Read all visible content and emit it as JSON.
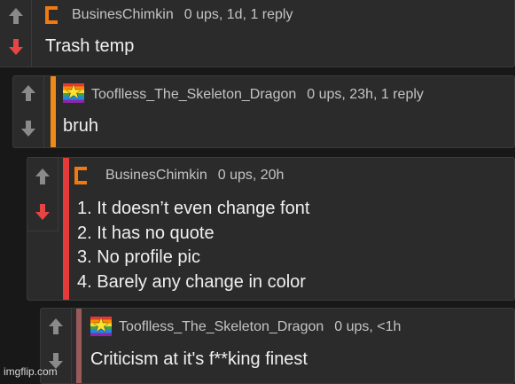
{
  "colors": {
    "upvote_gray": "#8a8a8a",
    "downvote_red": "#e64545",
    "bar_orange": "#f08a16",
    "bar_red": "#e53a3a",
    "bar_maroon": "#9a5a5a",
    "user_icon_orange": "#f07a10"
  },
  "comments": [
    {
      "username": "BusinesChimkin",
      "stats": "0 ups, 1d, 1 reply",
      "text": "Trash temp",
      "downvoted": true
    },
    {
      "username": "Tooflless_The_Skeleton_Dragon",
      "stats": "0 ups, 23h, 1 reply",
      "text": "bruh",
      "downvoted": false
    },
    {
      "username": "BusinesChimkin",
      "stats": "0 ups, 20h",
      "lines": [
        "1. It doesn’t even change font",
        "2. It has no quote",
        "3. No profile pic",
        "4. Barely any change in color"
      ],
      "downvoted": true
    },
    {
      "username": "Tooflless_The_Skeleton_Dragon",
      "stats": "0 ups, <1h",
      "text": "Criticism at it's f**king finest",
      "downvoted": false
    }
  ],
  "watermark": "imgflip.com",
  "icons": {
    "upvote": "arrow-up-icon",
    "downvote": "arrow-down-icon",
    "star": "★"
  }
}
